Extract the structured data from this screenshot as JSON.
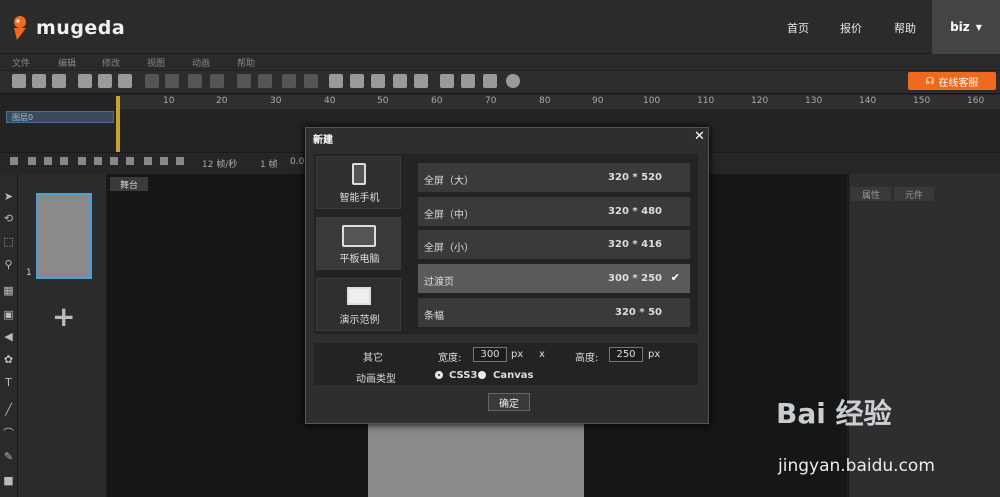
{
  "topnav": {
    "logo_text": "mugeda",
    "links": [
      "首页",
      "报价",
      "帮助"
    ],
    "user": "biz"
  },
  "menu": [
    "文件",
    "编辑",
    "修改",
    "视图",
    "动画",
    "帮助"
  ],
  "toolbar": {
    "online_service": "在线客服"
  },
  "timeline": {
    "ticks": [
      "10",
      "20",
      "30",
      "40",
      "50",
      "60",
      "70",
      "80",
      "90",
      "100",
      "110",
      "120",
      "130",
      "140",
      "150",
      "160"
    ],
    "layer_name": "图层0",
    "fps": "12 帧/秒",
    "frame": "1 帧",
    "time": "0.0"
  },
  "pages": {
    "page_number": "1"
  },
  "stage": {
    "tab": "舞台"
  },
  "right_panel": {
    "tabs": [
      "属性",
      "元件"
    ]
  },
  "dialog": {
    "title": "新建",
    "devices": [
      "智能手机",
      "平板电脑",
      "演示范例"
    ],
    "sizes": [
      {
        "name": "全屏（大）",
        "value": "320 * 520"
      },
      {
        "name": "全屏（中）",
        "value": "320 * 480"
      },
      {
        "name": "全屏（小）",
        "value": "320 * 416"
      },
      {
        "name": "过渡页",
        "value": "300 * 250"
      },
      {
        "name": "条幅",
        "value": "320 * 50"
      }
    ],
    "other_label": "其它",
    "width_label": "宽度:",
    "width_value": "300",
    "width_unit": "px",
    "x_sep": "x",
    "height_label": "高度:",
    "height_value": "250",
    "height_unit": "px",
    "anim_type_label": "动画类型",
    "anim_css3": "CSS3",
    "anim_canvas": "Canvas",
    "ok": "确定"
  },
  "watermark": {
    "main": "Bai 经验",
    "url": "jingyan.baidu.com"
  },
  "colors": {
    "accent_orange": "#f06a1d",
    "selection_blue": "#4aa0d8"
  }
}
